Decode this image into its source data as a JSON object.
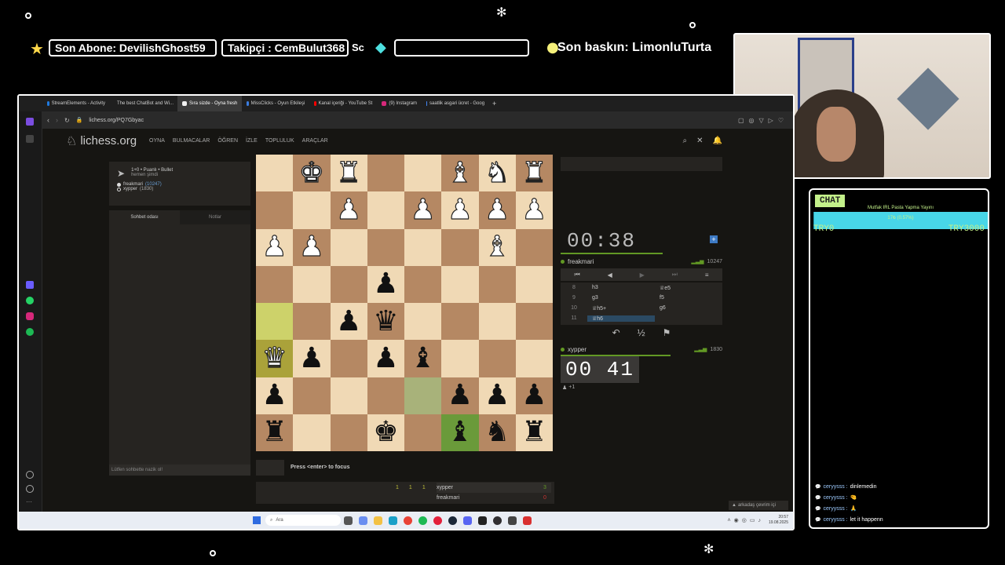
{
  "overlay": {
    "ticker_sub": "Son Abone: DevilishGhost59",
    "ticker_follow": "Takipçi : CemBulut368",
    "ticker_follow_tail": "Sc",
    "ticker_empty": "",
    "ticker_raid": "Son baskın: LimonluTurta"
  },
  "browser": {
    "tabs": [
      {
        "label": "StreamElements - Activity",
        "color": "#1f7ae0",
        "active": false
      },
      {
        "label": "The best ChatBot and Wi...",
        "color": "#e0e0e0",
        "active": false
      },
      {
        "label": "Sıra sizde - Oyna fresh",
        "color": "#f0f0f0",
        "active": true
      },
      {
        "label": "MissClicks - Oyun Etkileşi",
        "color": "#3b7de0",
        "active": false
      },
      {
        "label": "Kanal içeriği - YouTube St",
        "color": "#ff0000",
        "active": false
      },
      {
        "label": "(9) Instagram",
        "color": "#d6287a",
        "active": false
      },
      {
        "label": "saatlik asgari ücret - Goog",
        "color": "#4285f4",
        "active": false
      }
    ],
    "url": "lichess.org/PQ7Gbyac"
  },
  "lichess": {
    "logo": "lichess.org",
    "nav": [
      "OYNA",
      "BULMACALAR",
      "ÖĞREN",
      "İZLE",
      "TOPLULUK",
      "ARAÇLAR"
    ],
    "game_info": {
      "title": "1+0 • Puanlı • Bullet",
      "subtitle": "hemen şimdi",
      "player_white": "freakmari",
      "player_white_rating": "(10247)",
      "player_black": "xypper",
      "player_black_rating": "(1830)"
    },
    "chat_tabs": {
      "room": "Sohbet odası",
      "notes": "Notlar"
    },
    "chat_placeholder": "Lütfen sohbette nazik ol!",
    "focus_hint": "Press <enter> to focus",
    "crosstable": {
      "scores": [
        "1",
        "1",
        "1"
      ],
      "rows": [
        {
          "name": "xypper",
          "score": "3"
        },
        {
          "name": "freakmari",
          "score": "0"
        }
      ]
    },
    "opponent": {
      "clock": "00:38",
      "name": "freakmari",
      "rating": "10247"
    },
    "me": {
      "clock": "00 41",
      "name": "xypper",
      "rating": "1830"
    },
    "moves": [
      {
        "n": "8",
        "w": "h3",
        "b": "♕e5"
      },
      {
        "n": "9",
        "w": "g3",
        "b": "f5"
      },
      {
        "n": "10",
        "w": "♕h5+",
        "b": "g6"
      },
      {
        "n": "11",
        "w": "♕h6",
        "b": ""
      }
    ],
    "draw_label": "½",
    "plus_one": "+1",
    "friends": "arkadaş çevrim içi"
  },
  "board": [
    [
      "",
      "wK",
      "wR",
      "",
      "",
      "wB",
      "wN",
      "wR"
    ],
    [
      "",
      "",
      "wP",
      "",
      "wP",
      "wP",
      "wP",
      "wP"
    ],
    [
      "wP",
      "wP",
      "",
      "",
      "",
      "",
      "wB",
      ""
    ],
    [
      "",
      "",
      "",
      "bP",
      "",
      "",
      "",
      ""
    ],
    [
      "",
      "",
      "bP",
      "bQ",
      "",
      "",
      "",
      ""
    ],
    [
      "wQ",
      "bP",
      "",
      "bP",
      "bB",
      "",
      "",
      ""
    ],
    [
      "bP",
      "",
      "",
      "",
      "",
      "bP",
      "bP",
      "bP"
    ],
    [
      "bR",
      "",
      "",
      "bK",
      "",
      "bB",
      "bN",
      "bR"
    ]
  ],
  "taskbar": {
    "search": "Ara",
    "time": "20:57",
    "date": "19.08.2025"
  },
  "stream_chat": {
    "header": "CHAT",
    "goal_title": "Mutfak IRL Pasta Yapma Yayını",
    "goal_progress_text": "17₺ (0.57%)",
    "goal_fraction": 0.0057,
    "goal_min": "TRY0",
    "goal_max": "TRY3000",
    "messages": [
      {
        "user": "ceryysss :",
        "text": "dinlemedin"
      },
      {
        "user": "ceryysss :",
        "text": "🤏"
      },
      {
        "user": "ceryysss :",
        "text": "🙏"
      },
      {
        "user": "ceryysss :",
        "text": "let it happenn"
      }
    ]
  }
}
